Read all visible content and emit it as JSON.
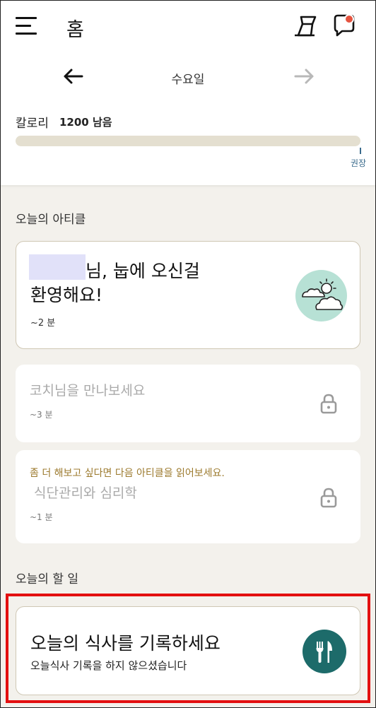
{
  "header": {
    "title": "홈",
    "day": "수요일"
  },
  "calorie": {
    "label": "칼로리",
    "remaining": "1200 남음",
    "recommended_label": "권장",
    "consumed_fraction": 0
  },
  "articles": {
    "section_title": "오늘의 아티클",
    "welcome": {
      "title_line1": "님, 눕에 오신걸",
      "title_line2": "환영해요!",
      "time": "~2 분"
    },
    "coach": {
      "title": "코치님을 만나보세요",
      "time": "~3 분"
    },
    "psych": {
      "note": "좀 더 해보고 싶다면 다음 아티클을 읽어보세요.",
      "title": "식단관리와 심리학",
      "time": "~1 분"
    }
  },
  "todo": {
    "section_title": "오늘의 할 일",
    "meal": {
      "title": "오늘의 식사를 기록하세요",
      "subtitle": "오늘식사 기록을 하지 않으셨습니다"
    }
  },
  "colors": {
    "accent_teal": "#1d6b6a",
    "highlight_red": "#e31010",
    "notification_dot": "#e5533f",
    "note_gold": "#9c7a2e"
  },
  "icons": {
    "menu": "hamburger-menu-icon",
    "report": "report-icon",
    "chat": "chat-icon",
    "prev": "arrow-left-icon",
    "next": "arrow-right-icon",
    "weather": "weather-icon",
    "lock": "lock-icon",
    "meal": "fork-knife-icon"
  }
}
